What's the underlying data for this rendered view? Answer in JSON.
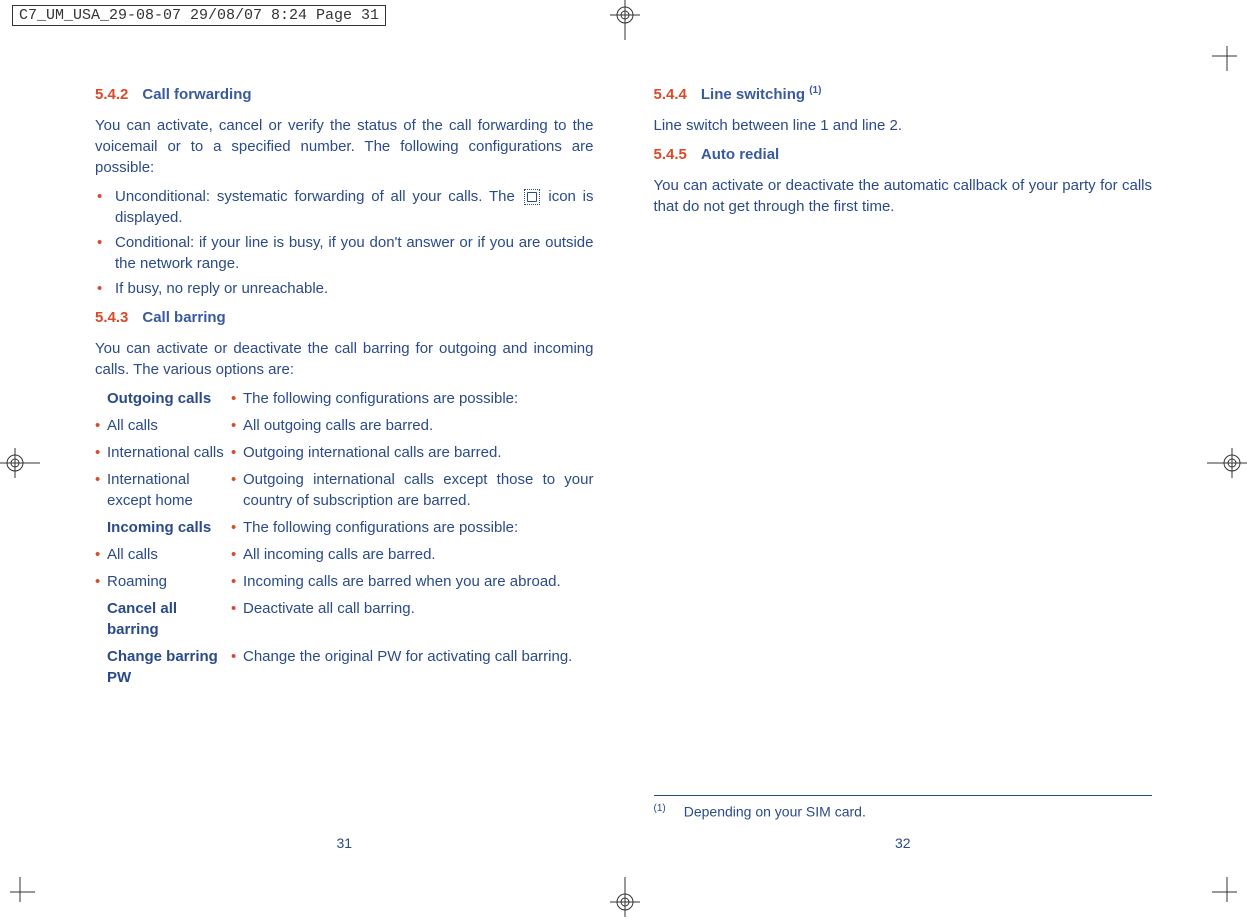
{
  "print_header": "C7_UM_USA_29-08-07  29/08/07  8:24  Page 31",
  "left": {
    "s542": {
      "num": "5.4.2",
      "title": "Call forwarding",
      "intro": "You can activate, cancel or verify the status of the call forwarding to the voicemail or to a specified number. The following configurations are possible:",
      "b1a": "Unconditional: systematic forwarding of all your calls. The ",
      "b1b": " icon is displayed.",
      "b2": "Conditional: if your line is busy, if you don't answer or if you are outside the network range.",
      "b3": "If busy, no reply or unreachable."
    },
    "s543": {
      "num": "5.4.3",
      "title": "Call barring",
      "intro": "You can activate or deactivate the call barring for outgoing and incoming calls. The various options are:",
      "rows": [
        {
          "l": "Outgoing calls",
          "lbold": true,
          "ldot": false,
          "r": "The following configurations are possible:"
        },
        {
          "l": "All calls",
          "lbold": false,
          "ldot": true,
          "r": "All outgoing calls are barred."
        },
        {
          "l": "International calls",
          "lbold": false,
          "ldot": true,
          "r": "Outgoing international calls are barred."
        },
        {
          "l": "International except home",
          "lbold": false,
          "ldot": true,
          "r": "Outgoing international calls except those to your country of subscription are barred."
        },
        {
          "l": "Incoming calls",
          "lbold": true,
          "ldot": false,
          "r": "The following configurations are possible:"
        },
        {
          "l": "All calls",
          "lbold": false,
          "ldot": true,
          "r": "All incoming calls are barred."
        },
        {
          "l": "Roaming",
          "lbold": false,
          "ldot": true,
          "r": "Incoming calls are barred when you are abroad."
        },
        {
          "l": "Cancel all barring",
          "lbold": true,
          "ldot": false,
          "r": "Deactivate all call barring."
        },
        {
          "l": "Change barring PW",
          "lbold": true,
          "ldot": false,
          "r": "Change the original PW for activating call barring."
        }
      ]
    },
    "pagenum": "31"
  },
  "right": {
    "s544": {
      "num": "5.4.4",
      "title": "Line switching ",
      "sup": "(1)",
      "body": "Line switch between line 1 and line 2."
    },
    "s545": {
      "num": "5.4.5",
      "title": "Auto redial",
      "body": "You can activate or deactivate the automatic callback of your party for calls that do not get through the first time."
    },
    "footnote_sup": "(1)",
    "footnote": "Depending on your SIM card.",
    "pagenum": "32"
  }
}
